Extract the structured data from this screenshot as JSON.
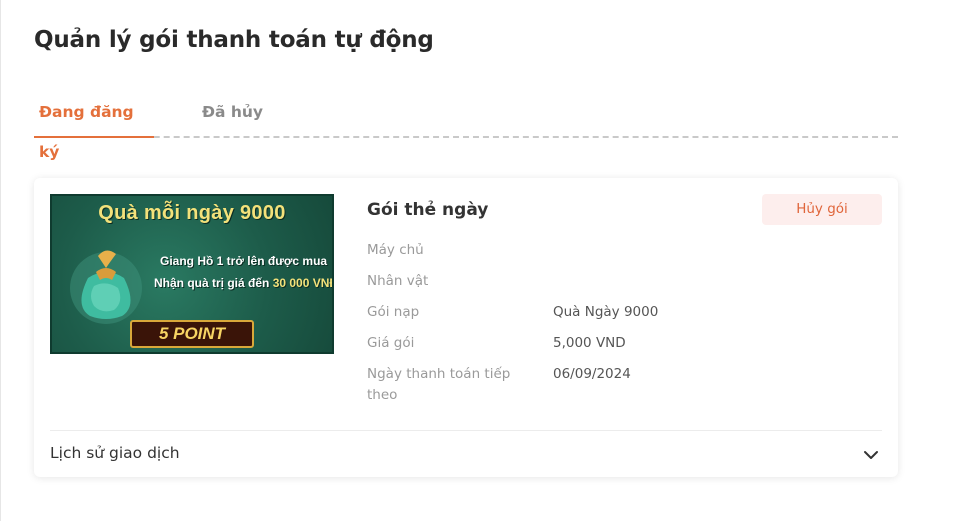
{
  "page": {
    "title": "Quản lý gói thanh toán tự động"
  },
  "tabs": [
    {
      "label": "Đang đăng ký",
      "active": true
    },
    {
      "label": "Đã hủy",
      "active": false
    }
  ],
  "card": {
    "banner": {
      "title": "Quà mỗi ngày 9000",
      "line1": "Giang Hồ 1 trở lên được mua",
      "line2_prefix": "Nhận quà trị giá đến ",
      "line2_highlight": "30 000 VNĐ",
      "point": "5 POINT",
      "icon": "gift-bag-icon"
    },
    "package_name": "Gói thẻ ngày",
    "cancel_label": "Hủy gói",
    "fields": [
      {
        "label": "Máy chủ",
        "value": ""
      },
      {
        "label": "Nhân vật",
        "value": ""
      },
      {
        "label": "Gói nạp",
        "value": "Quà Ngày 9000"
      },
      {
        "label": "Giá gói",
        "value": "5,000 VND"
      },
      {
        "label": "Ngày thanh toán tiếp theo",
        "value": "06/09/2024"
      }
    ],
    "history_label": "Lịch sử giao dịch"
  },
  "colors": {
    "accent": "#e4703b",
    "cancel_bg": "#fdeeed",
    "banner_bg": "#1d5c4a"
  }
}
